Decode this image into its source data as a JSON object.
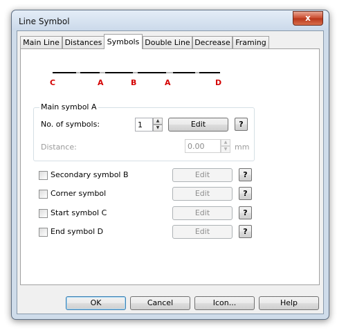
{
  "window": {
    "title": "Line Symbol",
    "close_glyph": "x"
  },
  "tabs": [
    {
      "label": "Main Line"
    },
    {
      "label": "Distances"
    },
    {
      "label": "Symbols"
    },
    {
      "label": "Double Line"
    },
    {
      "label": "Decrease"
    },
    {
      "label": "Framing"
    }
  ],
  "active_tab": "Symbols",
  "diagram": {
    "labels": [
      "C",
      "A",
      "B",
      "A",
      "D"
    ],
    "label_color": "#d40000"
  },
  "main_symbol": {
    "group_title": "Main symbol A",
    "count_label": "No. of symbols:",
    "count_value": "1",
    "edit_label": "Edit",
    "help_label": "?",
    "distance_label": "Distance:",
    "distance_value": "0.00",
    "distance_unit": "mm"
  },
  "symbols": [
    {
      "label": "Secondary symbol B",
      "checked": false,
      "edit_label": "Edit",
      "help_label": "?"
    },
    {
      "label": "Corner symbol",
      "checked": false,
      "edit_label": "Edit",
      "help_label": "?"
    },
    {
      "label": "Start symbol C",
      "checked": false,
      "edit_label": "Edit",
      "help_label": "?"
    },
    {
      "label": "End symbol D",
      "checked": false,
      "edit_label": "Edit",
      "help_label": "?"
    }
  ],
  "footer": {
    "ok_label": "OK",
    "cancel_label": "Cancel",
    "icon_label": "Icon...",
    "help_label": "Help"
  },
  "colors": {
    "accent": "#3c7fb1",
    "close_button": "#c9482b"
  }
}
